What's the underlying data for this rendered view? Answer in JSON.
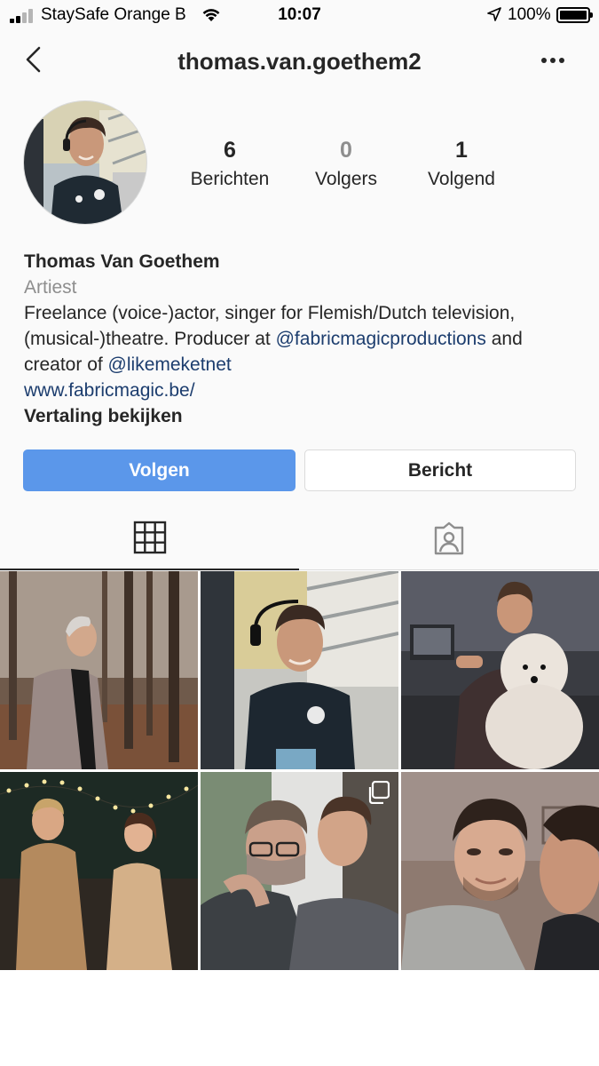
{
  "status_bar": {
    "carrier": "StaySafe Orange B",
    "time": "10:07",
    "battery": "100%"
  },
  "nav": {
    "title": "thomas.van.goethem2",
    "back_icon": "chevron-left-icon",
    "more_icon": "more-dots-icon"
  },
  "stats": {
    "posts_count": "6",
    "posts_label": "Berichten",
    "followers_count": "0",
    "followers_label": "Volgers",
    "following_count": "1",
    "following_label": "Volgend"
  },
  "bio": {
    "name": "Thomas Van Goethem",
    "category": "Artiest",
    "text_1": "Freelance (voice-)actor, singer for Flemish/Dutch television, (musical-)theatre. Producer at ",
    "mention_1": "@fabricmagicproductions",
    "text_2": " and creator of ",
    "mention_2": "@likemeketnet",
    "website": "www.fabricmagic.be/",
    "translate": "Vertaling bekijken"
  },
  "actions": {
    "follow_label": "Volgen",
    "message_label": "Bericht"
  },
  "tabs": {
    "grid_icon": "grid-icon",
    "tagged_icon": "tagged-person-icon"
  },
  "colors": {
    "follow_button": "#5b97ea",
    "link": "#1c3d6e",
    "muted": "#8e8e8e"
  }
}
